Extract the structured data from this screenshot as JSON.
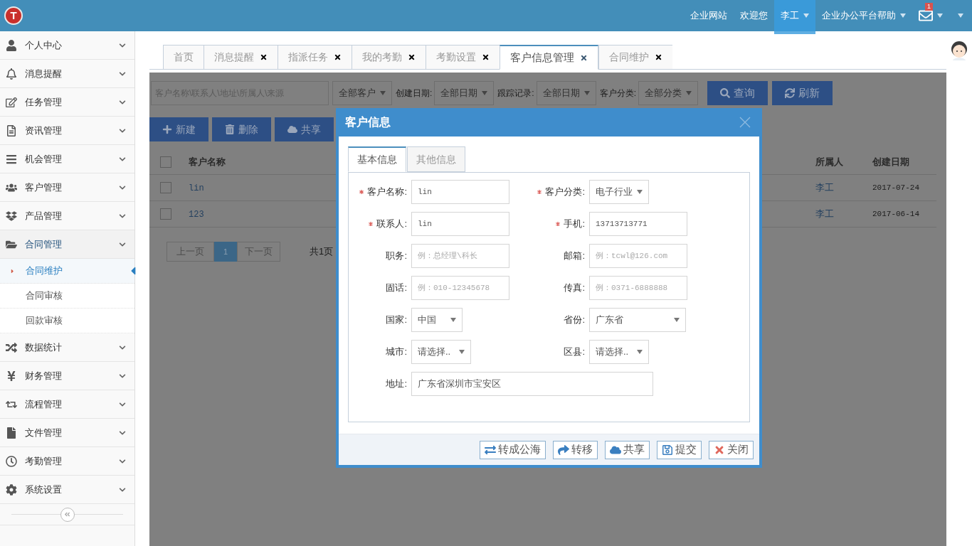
{
  "header": {
    "logo_mark": "T",
    "nav": [
      {
        "label": "企业网站",
        "active": false,
        "dropdown": false
      },
      {
        "label": "欢迎您",
        "active": false,
        "dropdown": false
      },
      {
        "label": "李工",
        "active": true,
        "dropdown": true
      },
      {
        "label": "企业办公平台帮助",
        "active": false,
        "dropdown": true
      }
    ],
    "mail_badge": "1"
  },
  "sidebar": {
    "items": [
      {
        "label": "个人中心",
        "expanded": false
      },
      {
        "label": "消息提醒",
        "expanded": false
      },
      {
        "label": "任务管理",
        "expanded": false
      },
      {
        "label": "资讯管理",
        "expanded": false
      },
      {
        "label": "机会管理",
        "expanded": false
      },
      {
        "label": "客户管理",
        "expanded": false
      },
      {
        "label": "产品管理",
        "expanded": false
      },
      {
        "label": "合同管理",
        "expanded": true,
        "children": [
          {
            "label": "合同维护",
            "selected": true
          },
          {
            "label": "合同审核",
            "selected": false
          },
          {
            "label": "回款审核",
            "selected": false
          }
        ]
      },
      {
        "label": "数据统计",
        "expanded": false
      },
      {
        "label": "财务管理",
        "expanded": false
      },
      {
        "label": "流程管理",
        "expanded": false
      },
      {
        "label": "文件管理",
        "expanded": false
      },
      {
        "label": "考勤管理",
        "expanded": false
      },
      {
        "label": "系统设置",
        "expanded": false
      }
    ]
  },
  "tabs": [
    {
      "label": "首页",
      "closable": false,
      "selected": false
    },
    {
      "label": "消息提醒",
      "closable": true,
      "selected": false
    },
    {
      "label": "指派任务",
      "closable": true,
      "selected": false
    },
    {
      "label": "我的考勤",
      "closable": true,
      "selected": false
    },
    {
      "label": "考勤设置",
      "closable": true,
      "selected": false
    },
    {
      "label": "客户信息管理",
      "closable": true,
      "selected": true
    },
    {
      "label": "合同维护",
      "closable": true,
      "selected": false
    }
  ],
  "toolbar": {
    "search": {
      "placeholder": "客户名称\\联系人\\地址\\所属人\\来源"
    },
    "filters": [
      {
        "value": "全部客户"
      },
      {
        "label": "创建日期:",
        "value": "全部日期"
      },
      {
        "label": "跟踪记录:",
        "value": "全部日期"
      },
      {
        "label": "客户分类:",
        "value": "全部分类"
      }
    ],
    "buttons": [
      "查询",
      "刷新"
    ],
    "actions": [
      "新建",
      "删除",
      "共享"
    ]
  },
  "table": {
    "all_checked": false,
    "columns": [
      "客户名称",
      "所属人",
      "创建日期"
    ],
    "rows": [
      {
        "checked": false,
        "cells": [
          "lin",
          "李工",
          "2017-07-24"
        ]
      },
      {
        "checked": false,
        "cells": [
          "123",
          "李工",
          "2017-06-14"
        ]
      }
    ]
  },
  "pagination": {
    "prev": "上一页",
    "pages": [
      {
        "label": "1",
        "selected": true
      }
    ],
    "next": "下一页",
    "total": "共1页"
  },
  "dialog": {
    "title": "客户信息",
    "tabs": [
      {
        "label": "基本信息",
        "selected": true
      },
      {
        "label": "其他信息",
        "selected": false
      }
    ],
    "rows": [
      [
        {
          "label": "客户名称:",
          "required": true,
          "kind": "input",
          "value": "lin"
        },
        {
          "label": "客户分类:",
          "required": true,
          "kind": "select",
          "value": "电子行业"
        }
      ],
      [
        {
          "label": "联系人:",
          "required": true,
          "kind": "input",
          "value": "lin"
        },
        {
          "label": "手机:",
          "required": true,
          "kind": "input",
          "value": "13713713771"
        }
      ],
      [
        {
          "label": "职务:",
          "required": false,
          "kind": "input",
          "placeholder": "例：总经理\\科长"
        },
        {
          "label": "邮箱:",
          "required": false,
          "kind": "input",
          "placeholder": "例：tcwl@126.com"
        }
      ],
      [
        {
          "label": "固话:",
          "required": false,
          "kind": "input",
          "placeholder": "例：010-12345678"
        },
        {
          "label": "传真:",
          "required": false,
          "kind": "input",
          "placeholder": "例：0371-6888888"
        }
      ],
      [
        {
          "label": "国家:",
          "required": false,
          "kind": "select",
          "value": "中国"
        },
        {
          "label": "省份:",
          "required": false,
          "kind": "select",
          "value": "广东省"
        }
      ],
      [
        {
          "label": "城市:",
          "required": false,
          "kind": "select",
          "value": "请选择.."
        },
        {
          "label": "区县:",
          "required": false,
          "kind": "select",
          "value": "请选择.."
        }
      ],
      [
        {
          "label": "地址:",
          "required": false,
          "kind": "input",
          "value": "广东省深圳市宝安区"
        }
      ]
    ],
    "buttons": [
      "转成公海",
      "转移",
      "共享",
      "提交",
      "关闭"
    ]
  }
}
